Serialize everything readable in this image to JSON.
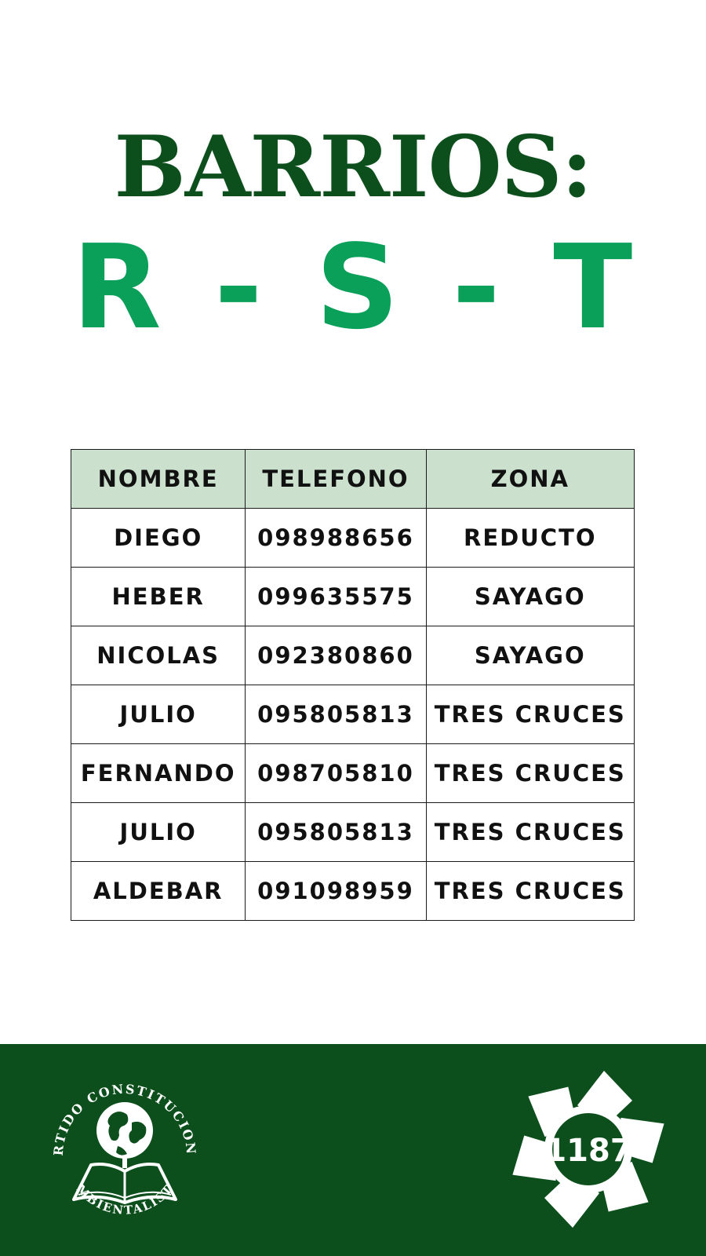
{
  "header": {
    "title": "BARRIOS:",
    "subtitle": "R - S - T"
  },
  "table": {
    "headers": [
      "NOMBRE",
      "TELEFONO",
      "ZONA"
    ],
    "rows": [
      [
        "DIEGO",
        "098988656",
        "REDUCTO"
      ],
      [
        "HEBER",
        "099635575",
        "SAYAGO"
      ],
      [
        "NICOLAS",
        "092380860",
        "SAYAGO"
      ],
      [
        "JULIO",
        "095805813",
        "TRES CRUCES"
      ],
      [
        "FERNANDO",
        "098705810",
        "TRES CRUCES"
      ],
      [
        "JULIO",
        "095805813",
        "TRES CRUCES"
      ],
      [
        "ALDEBAR",
        "091098959",
        "TRES CRUCES"
      ]
    ]
  },
  "footer": {
    "left_logo": {
      "icon": "globe-book-icon",
      "text_top": "PARTIDO CONSTITUCIONAL",
      "text_bottom": "AMBIENTALISTA"
    },
    "right_logo": {
      "icon": "pinwheel-icon",
      "number": "1187"
    }
  },
  "colors": {
    "title": "#0c4f1c",
    "subtitle": "#0aa05a",
    "header_bg": "#cbe0cd",
    "footer_bg": "#0c4f1c"
  }
}
